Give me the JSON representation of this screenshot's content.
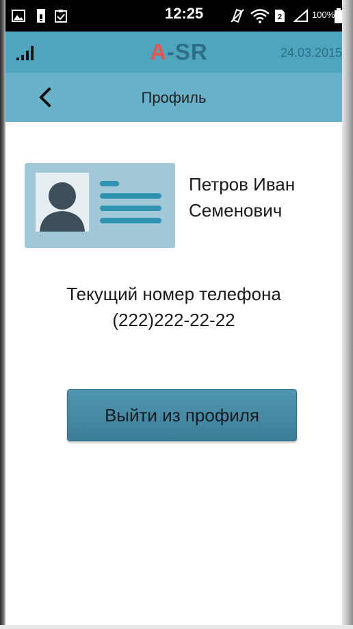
{
  "status_bar": {
    "time": "12:25",
    "battery_percent": "100%",
    "icons": [
      "image-icon",
      "sim-card-icon",
      "clipboard-check-icon",
      "vibrate-off-icon",
      "wifi-icon",
      "sim-slot-icon",
      "signal-triangle-icon",
      "battery-icon"
    ]
  },
  "header": {
    "logo_a": "A",
    "logo_rest": "-SR",
    "date": "24.03.2015",
    "signal_icon": "signal-bars-icon"
  },
  "nav": {
    "back_icon": "chevron-left-icon",
    "title": "Профиль"
  },
  "profile": {
    "card_icon": "id-card-icon",
    "name_line1": "Петров Иван",
    "name_line2": "Семенович",
    "phone_label": "Текущий номер телефона",
    "phone_value": "(222)222-22-22"
  },
  "actions": {
    "logout_label": "Выйти из профиля"
  },
  "colors": {
    "header_bg": "#4fa5be",
    "nav_bg": "#67b2c8",
    "logo_accent": "#e9544f",
    "logo_main": "#2f6f86",
    "button_bg": "#468aa3",
    "card_bg": "#a1c8d6"
  }
}
